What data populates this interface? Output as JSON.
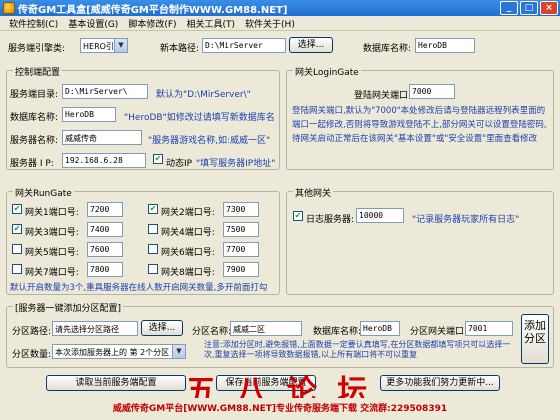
{
  "window": {
    "title": "传奇GM工具盒[威威传奇GM平台制作WWW.GM88.NET]",
    "controls": [
      "_",
      "□",
      "×"
    ]
  },
  "menu": [
    "软件控制(C)",
    "基本设置(G)",
    "脚本修改(F)",
    "相关工具(T)",
    "软件关于(H)"
  ],
  "top": {
    "engine_type_label": "服务端引擎类:",
    "engine_type_value": "HERO引擎",
    "new_path_label": "新本路径:",
    "new_path_value": "D:\\MirServer",
    "browse_label": "选择...",
    "db_name_label": "数据库名称:",
    "db_name_value": "HeroDB"
  },
  "control_config": {
    "title": "控制端配置",
    "server_dir_label": "服务端目录:",
    "server_dir_value": "D:\\MirServer\\",
    "server_dir_hint": "默认为\"D:\\MirServer\\\"",
    "db_label": "数据库名称:",
    "db_value": "HeroDB",
    "db_hint": "\"HeroDB\"如修改过请填写新数据库名",
    "server_name_label": "服务器名称:",
    "server_name_value": "威威传奇",
    "server_name_hint": "\"服务器游戏名称,如:威威一区\"",
    "ip_label": "服务器 I P:",
    "ip_value": "192.168.6.28",
    "dynamic_ip_label": "动态IP",
    "dynamic_ip_hint": "\"填写服务器IP地址\"",
    "dynamic_ip_checked": true
  },
  "login_gate": {
    "title": "网关LoginGate",
    "port_label": "登陆网关端口:",
    "port_value": "7000",
    "description": "登陆网关端口,默认为\"7000\"本处修改后请与登陆器远程列表里面的端口一起修改,否则将导致游戏登陆不上,部分网关可以设置登陆密码,待网关启动正常后在该网关\"基本设置\"或\"安全设置\"里面查看修改"
  },
  "run_gate": {
    "title": "网关RunGate",
    "gates": [
      {
        "label": "网关1端口号:",
        "value": "7200",
        "checked": true
      },
      {
        "label": "网关2端口号:",
        "value": "7300",
        "checked": true
      },
      {
        "label": "网关3端口号:",
        "value": "7400",
        "checked": true
      },
      {
        "label": "网关4端口号:",
        "value": "7500",
        "checked": false
      },
      {
        "label": "网关5端口号:",
        "value": "7600",
        "checked": false
      },
      {
        "label": "网关6端口号:",
        "value": "7700",
        "checked": false
      },
      {
        "label": "网关7端口号:",
        "value": "7800",
        "checked": false
      },
      {
        "label": "网关8端口号:",
        "value": "7900",
        "checked": false
      }
    ],
    "note": "默认开启数量为3个,重具服务器在线人数开启网关数量,多开前面打勾"
  },
  "other_gate": {
    "title": "其他网关",
    "log_label": "日志服务器:",
    "log_value": "10000",
    "log_checked": true,
    "log_hint": "\"记录服务器玩家所有日志\""
  },
  "partition": {
    "title": "[服务器一键添加分区配置]",
    "dir_label": "分区路径:",
    "dir_value": "请先选择分区路径",
    "browse_label": "选择...",
    "name_label": "分区名称:",
    "name_value": "威威二区",
    "db_label": "数据库名称:",
    "db_value": "HeroDB",
    "gate_port_label": "分区网关端口:",
    "gate_port_value": "7001",
    "count_label": "分区数量:",
    "count_value": "本次添加服务器上的 第 2个分区",
    "note": "注意:添加分区时,避免报错,上面数据一定要认真填写,在分区数据都填写项只可以选择一次,重复选择一项将导致数据报错,以上所有端口将不可以重复",
    "add_button": "添加分区"
  },
  "actions": {
    "read_config": "读取当前服务端配置",
    "save_config": "保存当前服务端配置",
    "more": "更多功能我们努力更新中..."
  },
  "brand_overlay": "五 八 论 坛",
  "status_text": "威威传奇GM平台[WWW.GM88.NET]专业传奇服务端下载 交流群:229508391"
}
